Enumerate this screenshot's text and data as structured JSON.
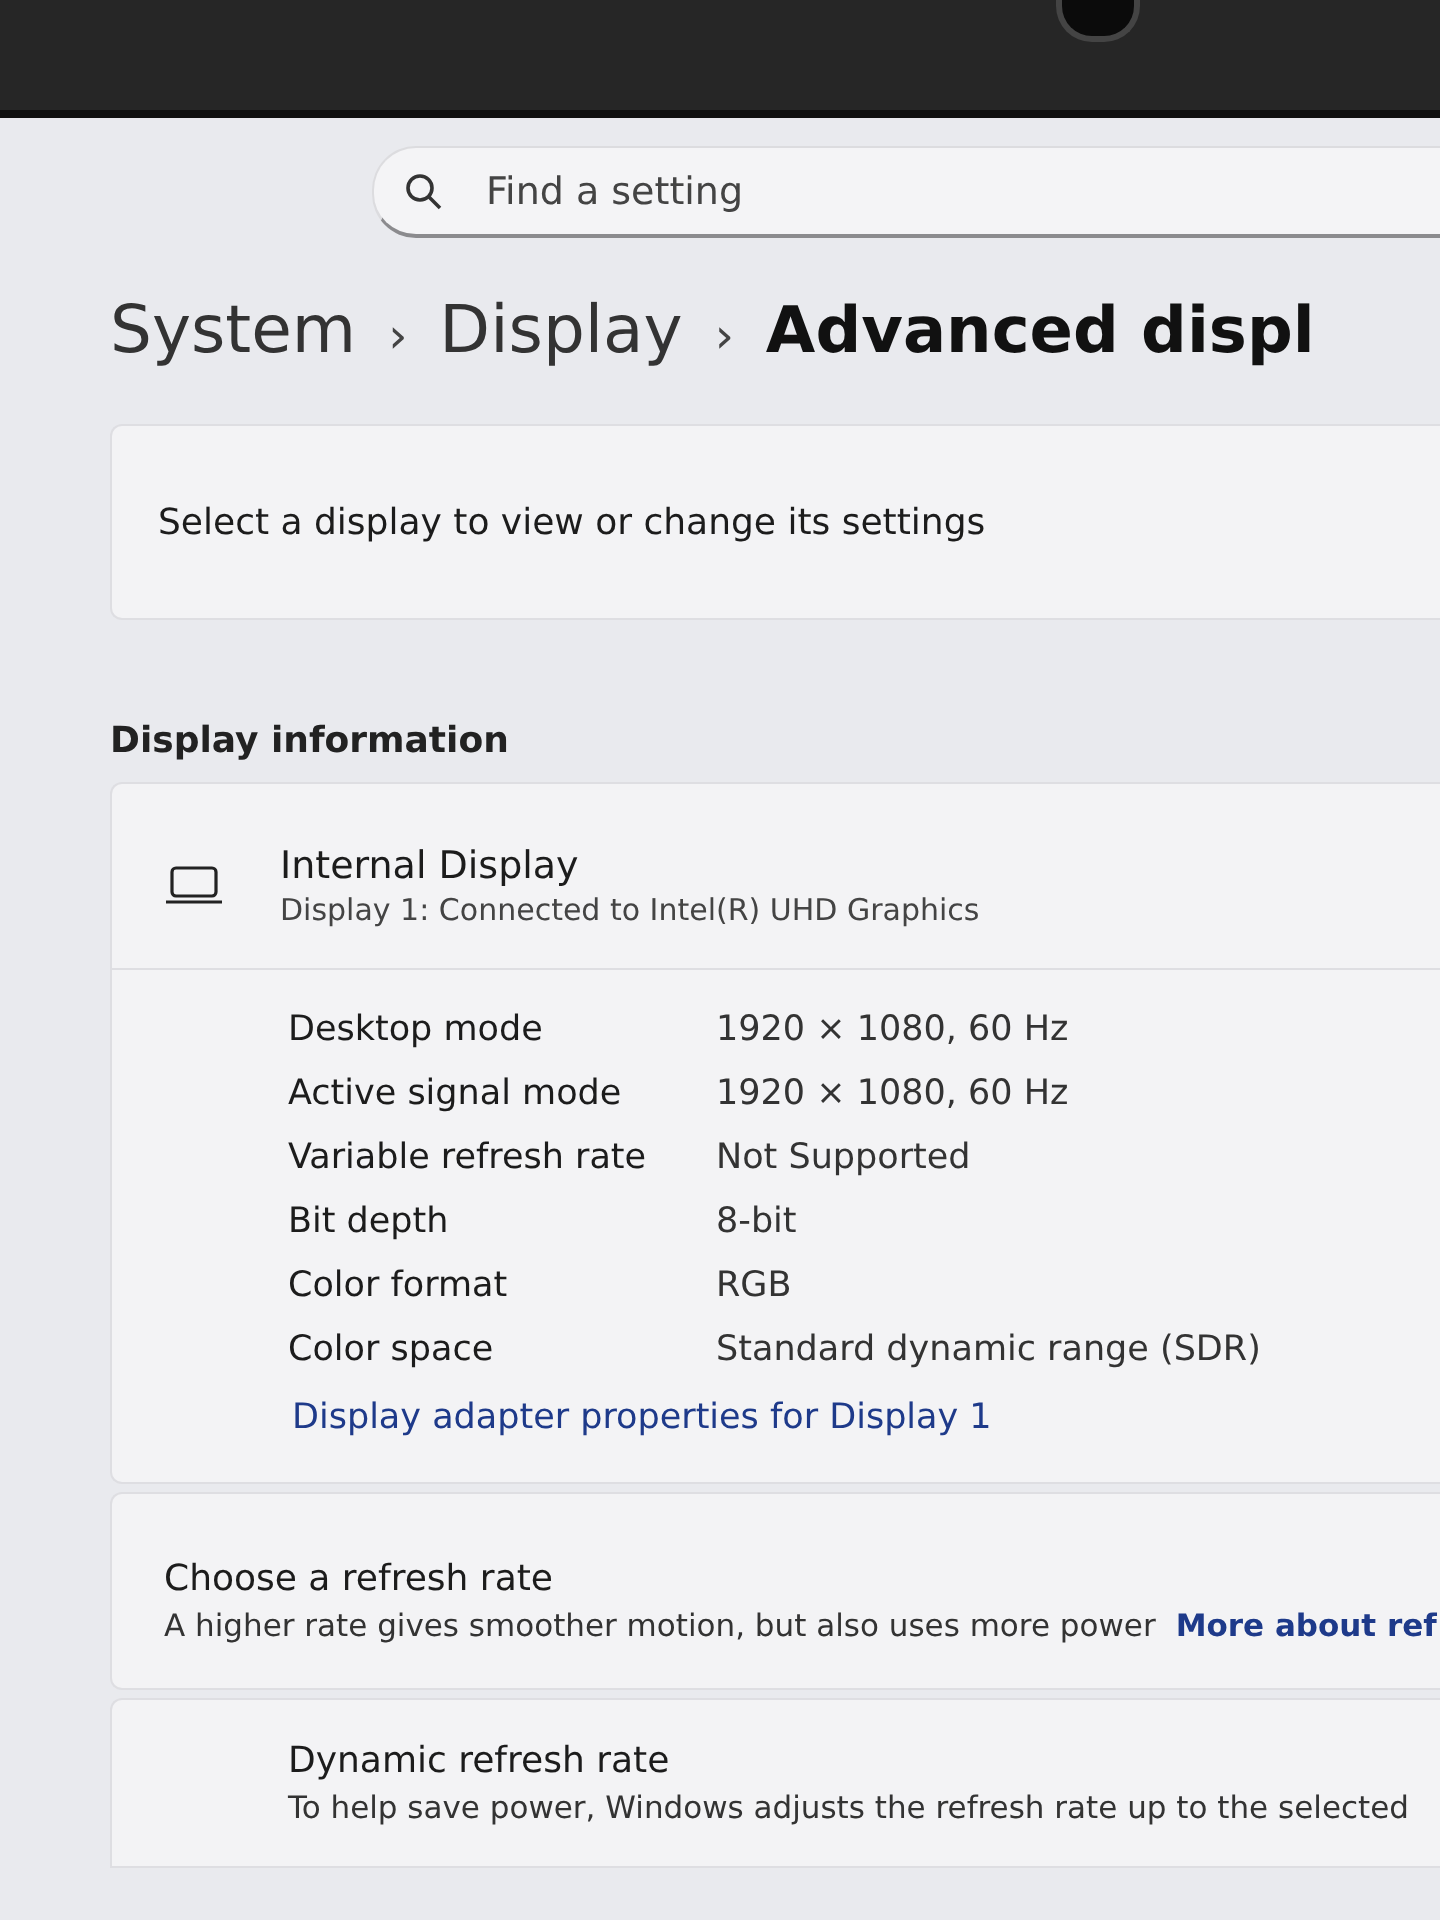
{
  "search": {
    "placeholder": "Find a setting"
  },
  "breadcrumb": [
    {
      "label": "System",
      "current": false
    },
    {
      "label": "Display",
      "current": false
    },
    {
      "label": "Advanced displ",
      "current": true
    }
  ],
  "breadcrumb_separator": "›",
  "select_card": {
    "text": "Select a display to view or change its settings"
  },
  "section_title": "Display information",
  "display": {
    "name": "Internal Display",
    "subtitle": "Display 1: Connected to Intel(R) UHD Graphics",
    "properties": [
      {
        "label": "Desktop mode",
        "value": "1920 × 1080, 60 Hz"
      },
      {
        "label": "Active signal mode",
        "value": "1920 × 1080, 60 Hz"
      },
      {
        "label": "Variable refresh rate",
        "value": "Not Supported"
      },
      {
        "label": "Bit depth",
        "value": "8-bit"
      },
      {
        "label": "Color format",
        "value": "RGB"
      },
      {
        "label": "Color space",
        "value": "Standard dynamic range (SDR)"
      }
    ],
    "link": "Display adapter properties for Display 1"
  },
  "refresh_card": {
    "title": "Choose a refresh rate",
    "description": "A higher rate gives smoother motion, but also uses more power",
    "link": "More about ref"
  },
  "dynamic_card": {
    "title": "Dynamic refresh rate",
    "description": "To help save power, Windows adjusts the refresh rate up to the selected"
  }
}
